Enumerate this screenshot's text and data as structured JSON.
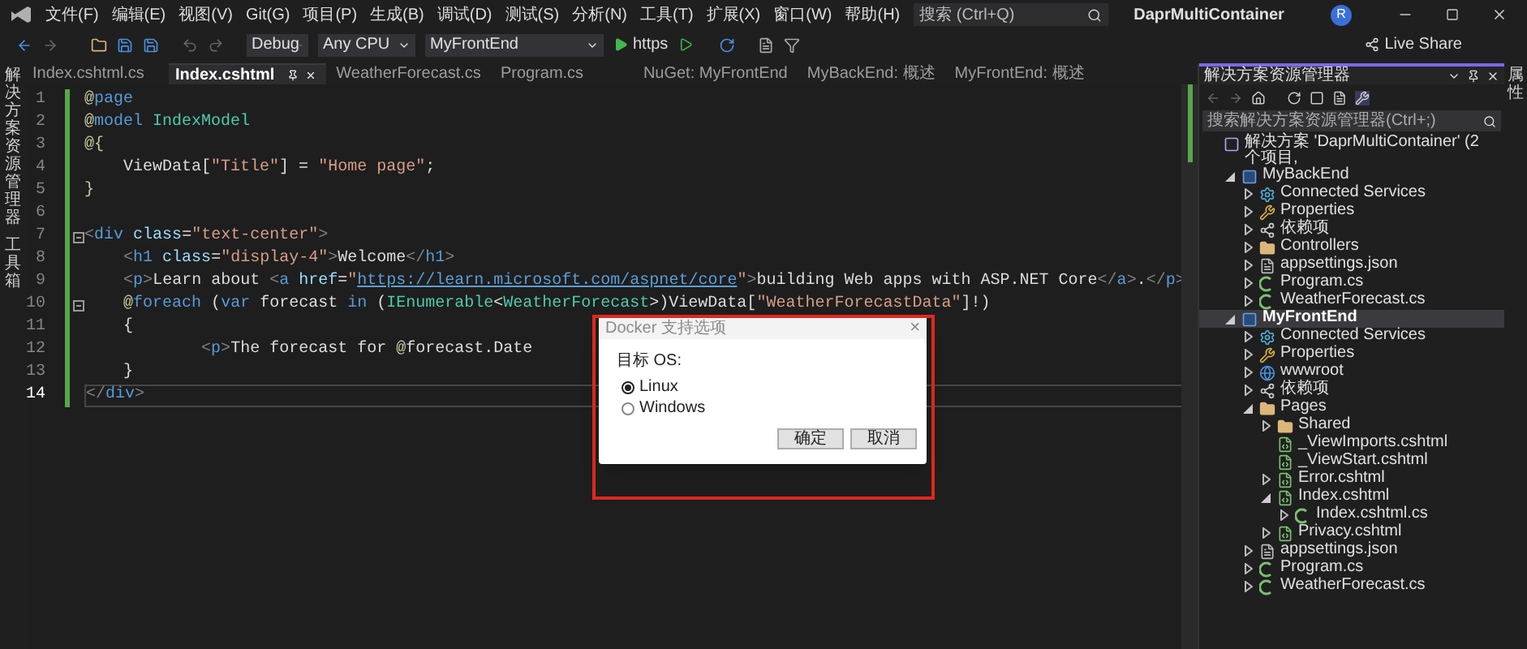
{
  "menu": {
    "items": [
      "文件(F)",
      "编辑(E)",
      "视图(V)",
      "Git(G)",
      "项目(P)",
      "生成(B)",
      "调试(D)",
      "测试(S)",
      "分析(N)",
      "工具(T)",
      "扩展(X)",
      "窗口(W)",
      "帮助(H)"
    ],
    "search": {
      "placeholder": "搜索 (Ctrl+Q)"
    },
    "title": "DaprMultiContainer",
    "avatar": "R"
  },
  "toolbar": {
    "configuration": "Debug",
    "platform": "Any CPU",
    "startup": "MyFrontEnd",
    "run_label": "https",
    "live_share": "Live Share"
  },
  "left_strip": [
    "解决方案资源管理器",
    "工具箱"
  ],
  "right_strip": [
    "属性"
  ],
  "tabs": [
    {
      "label": "Index.cshtml.cs",
      "selected": false
    },
    {
      "label": "Index.cshtml",
      "selected": true
    },
    {
      "label": "WeatherForecast.cs",
      "selected": false
    },
    {
      "label": "Program.cs",
      "selected": false
    },
    {
      "label": "NuGet: MyFrontEnd",
      "selected": false
    },
    {
      "label": "MyBackEnd: 概述",
      "selected": false
    },
    {
      "label": "MyFrontEnd: 概述",
      "selected": false
    }
  ],
  "editor": {
    "lines": [
      {
        "number": "1",
        "current": false,
        "fold": false,
        "tokens": [
          {
            "text": "@",
            "kind": "razor"
          },
          {
            "text": "page",
            "kind": "kw"
          }
        ]
      },
      {
        "number": "2",
        "current": false,
        "fold": false,
        "tokens": [
          {
            "text": "@",
            "kind": "razor"
          },
          {
            "text": "model ",
            "kind": "kw"
          },
          {
            "text": "IndexModel",
            "kind": "type"
          }
        ]
      },
      {
        "number": "3",
        "current": false,
        "fold": false,
        "tokens": [
          {
            "text": "@{",
            "kind": "razor"
          }
        ]
      },
      {
        "number": "4",
        "current": false,
        "fold": false,
        "tokens": [
          {
            "text": "    ViewData[",
            "kind": "text"
          },
          {
            "text": "\"Title\"",
            "kind": "str"
          },
          {
            "text": "] = ",
            "kind": "text"
          },
          {
            "text": "\"Home page\"",
            "kind": "str"
          },
          {
            "text": ";",
            "kind": "text"
          }
        ]
      },
      {
        "number": "5",
        "current": false,
        "fold": false,
        "tokens": [
          {
            "text": "}",
            "kind": "razor"
          }
        ]
      },
      {
        "number": "6",
        "current": false,
        "fold": false
      },
      {
        "number": "7",
        "current": false,
        "fold": true,
        "tokens": [
          {
            "text": "<",
            "kind": "punct"
          },
          {
            "text": "div",
            "kind": "tag"
          },
          {
            "text": " class",
            "kind": "attr"
          },
          {
            "text": "=",
            "kind": "text"
          },
          {
            "text": "\"text-center\"",
            "kind": "str"
          },
          {
            "text": ">",
            "kind": "punct"
          }
        ]
      },
      {
        "number": "8",
        "current": false,
        "fold": false,
        "tokens": [
          {
            "text": "    <",
            "kind": "punct"
          },
          {
            "text": "h1",
            "kind": "tag"
          },
          {
            "text": " class",
            "kind": "attr"
          },
          {
            "text": "=",
            "kind": "text"
          },
          {
            "text": "\"display-4\"",
            "kind": "str"
          },
          {
            "text": ">",
            "kind": "punct"
          },
          {
            "text": "Welcome",
            "kind": "text"
          },
          {
            "text": "</",
            "kind": "punct"
          },
          {
            "text": "h1",
            "kind": "tag"
          },
          {
            "text": ">",
            "kind": "punct"
          }
        ]
      },
      {
        "number": "9",
        "current": false,
        "fold": false,
        "tokens": [
          {
            "text": "    <",
            "kind": "punct"
          },
          {
            "text": "p",
            "kind": "tag"
          },
          {
            "text": ">",
            "kind": "punct"
          },
          {
            "text": "Learn about ",
            "kind": "text"
          },
          {
            "text": "<",
            "kind": "punct"
          },
          {
            "text": "a",
            "kind": "tag"
          },
          {
            "text": " href",
            "kind": "attr"
          },
          {
            "text": "=",
            "kind": "text"
          },
          {
            "text": "\"",
            "kind": "str"
          },
          {
            "text": "https://learn.microsoft.com/aspnet/core",
            "kind": "link"
          },
          {
            "text": "\"",
            "kind": "str"
          },
          {
            "text": ">",
            "kind": "punct"
          },
          {
            "text": "building Web apps with ASP.NET Core",
            "kind": "text"
          },
          {
            "text": "</",
            "kind": "punct"
          },
          {
            "text": "a",
            "kind": "tag"
          },
          {
            "text": ">",
            "kind": "punct"
          },
          {
            "text": ".",
            "kind": "text"
          },
          {
            "text": "</",
            "kind": "punct"
          },
          {
            "text": "p",
            "kind": "tag"
          },
          {
            "text": ">",
            "kind": "punct"
          }
        ]
      },
      {
        "number": "10",
        "current": false,
        "fold": true,
        "tokens": [
          {
            "text": "    @",
            "kind": "razor"
          },
          {
            "text": "foreach",
            "kind": "kw"
          },
          {
            "text": " (",
            "kind": "text"
          },
          {
            "text": "var",
            "kind": "kw"
          },
          {
            "text": " forecast ",
            "kind": "text"
          },
          {
            "text": "in",
            "kind": "kw"
          },
          {
            "text": " (",
            "kind": "text"
          },
          {
            "text": "IEnumerable",
            "kind": "type"
          },
          {
            "text": "<",
            "kind": "text"
          },
          {
            "text": "WeatherForecast",
            "kind": "type"
          },
          {
            "text": ">)ViewData[",
            "kind": "text"
          },
          {
            "text": "\"WeatherForecastData\"",
            "kind": "str"
          },
          {
            "text": "]!)",
            "kind": "text"
          }
        ]
      },
      {
        "number": "11",
        "current": false,
        "fold": false,
        "tokens": [
          {
            "text": "    {",
            "kind": "text"
          }
        ]
      },
      {
        "number": "12",
        "current": false,
        "fold": false,
        "tokens": [
          {
            "text": "            <",
            "kind": "punct"
          },
          {
            "text": "p",
            "kind": "tag"
          },
          {
            "text": ">",
            "kind": "punct"
          },
          {
            "text": "The forecast for ",
            "kind": "text"
          },
          {
            "text": "@",
            "kind": "razor"
          },
          {
            "text": "forecast.Date",
            "kind": "text"
          }
        ]
      },
      {
        "number": "13",
        "current": false,
        "fold": false,
        "tokens": [
          {
            "text": "    }",
            "kind": "text"
          }
        ]
      },
      {
        "number": "14",
        "current": true,
        "fold": false,
        "tokens": [
          {
            "text": "</",
            "kind": "punct"
          },
          {
            "text": "div",
            "kind": "tag"
          },
          {
            "text": ">",
            "kind": "punct"
          }
        ]
      }
    ]
  },
  "dialog": {
    "title": "Docker 支持选项",
    "close": "×",
    "label": "目标 OS:",
    "options": [
      {
        "label": "Linux",
        "selected": true
      },
      {
        "label": "Windows",
        "selected": false
      }
    ],
    "buttons": [
      "确定",
      "取消"
    ]
  },
  "solution_explorer": {
    "title": "解决方案资源管理器",
    "search": {
      "placeholder": "搜索解决方案资源管理器(Ctrl+;)"
    },
    "tree": [
      {
        "label": "解决方案 'DaprMultiContainer' (2 个项目,",
        "kind": "solution",
        "selected": false,
        "children": [
          {
            "label": "MyBackEnd",
            "kind": "project",
            "selected": false,
            "expanded": true,
            "children": [
              {
                "label": "Connected Services",
                "kind": "connected",
                "selected": false,
                "expanded": false
              },
              {
                "label": "Properties",
                "kind": "properties",
                "selected": false,
                "expanded": false
              },
              {
                "label": "依赖项",
                "kind": "deps",
                "selected": false,
                "expanded": false
              },
              {
                "label": "Controllers",
                "kind": "folder",
                "selected": false,
                "expanded": false
              },
              {
                "label": "appsettings.json",
                "kind": "json",
                "selected": false,
                "expanded": false
              },
              {
                "label": "Program.cs",
                "kind": "cs",
                "selected": false,
                "expanded": false
              },
              {
                "label": "WeatherForecast.cs",
                "kind": "cs",
                "selected": false,
                "expanded": false
              }
            ]
          },
          {
            "label": "MyFrontEnd",
            "kind": "project",
            "selected": true,
            "expanded": true,
            "children": [
              {
                "label": "Connected Services",
                "kind": "connected",
                "selected": false,
                "expanded": false
              },
              {
                "label": "Properties",
                "kind": "properties",
                "selected": false,
                "expanded": false
              },
              {
                "label": "wwwroot",
                "kind": "web",
                "selected": false,
                "expanded": false
              },
              {
                "label": "依赖项",
                "kind": "deps",
                "selected": false,
                "expanded": false
              },
              {
                "label": "Pages",
                "kind": "folder",
                "selected": false,
                "expanded": true,
                "children": [
                  {
                    "label": "Shared",
                    "kind": "folder",
                    "selected": false,
                    "expanded": false
                  },
                  {
                    "label": "_ViewImports.cshtml",
                    "kind": "cshtml",
                    "selected": false
                  },
                  {
                    "label": "_ViewStart.cshtml",
                    "kind": "cshtml",
                    "selected": false
                  },
                  {
                    "label": "Error.cshtml",
                    "kind": "cshtml",
                    "selected": false,
                    "expanded": false
                  },
                  {
                    "label": "Index.cshtml",
                    "kind": "cshtml",
                    "selected": false,
                    "expanded": true,
                    "children": [
                      {
                        "label": "Index.cshtml.cs",
                        "kind": "cs",
                        "selected": false,
                        "expanded": false
                      }
                    ]
                  },
                  {
                    "label": "Privacy.cshtml",
                    "kind": "cshtml",
                    "selected": false,
                    "expanded": false
                  }
                ]
              },
              {
                "label": "appsettings.json",
                "kind": "json",
                "selected": false,
                "expanded": false
              },
              {
                "label": "Program.cs",
                "kind": "cs",
                "selected": false,
                "expanded": false
              },
              {
                "label": "WeatherForecast.cs",
                "kind": "cs",
                "selected": false,
                "expanded": false
              }
            ]
          }
        ]
      }
    ]
  }
}
